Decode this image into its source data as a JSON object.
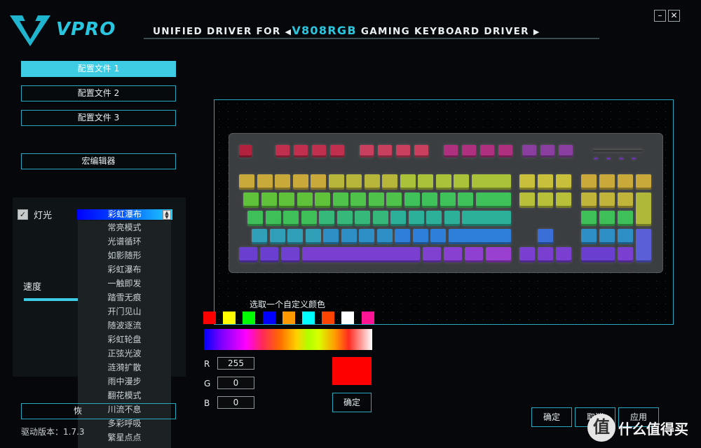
{
  "header": {
    "brand": "VPRO",
    "title_prefix": "UNIFIED DRIVER FOR",
    "model": "V808RGB",
    "title_suffix": "GAMING KEYBOARD DRIVER",
    "minimize_label": "–",
    "close_label": "✕"
  },
  "profiles": [
    "配置文件 1",
    "配置文件 2",
    "配置文件 3"
  ],
  "active_profile": 0,
  "macro_editor_label": "宏编辑器",
  "light": {
    "label": "灯光",
    "checked": true,
    "selected_mode": "彩虹瀑布",
    "modes": [
      "常亮模式",
      "光谱循环",
      "如影随形",
      "彩虹瀑布",
      "一触即发",
      "踏雪无痕",
      "开门见山",
      "随波逐流",
      "彩虹轮盘",
      "正弦光波",
      "涟漪扩散",
      "雨中漫步",
      "翻花模式",
      "川流不息",
      "多彩呼吸",
      "繁星点点"
    ],
    "speed_label": "速度"
  },
  "bottom_left_button": "恢",
  "driver_version": "驱动版本：1.7.3",
  "color_picker": {
    "title": "选取一个自定义颜色",
    "swatches": [
      "#ff0000",
      "#ffff00",
      "#00ff00",
      "#0000ff",
      "#ff9900",
      "#00ffff",
      "#ff4400",
      "#ffffff",
      "#ff1493"
    ],
    "r_label": "R",
    "r_value": "255",
    "g_label": "G",
    "g_value": "0",
    "b_label": "B",
    "b_value": "0",
    "preview_color": "#ff0000",
    "confirm_label": "确定"
  },
  "footer_buttons": {
    "ok": "确定",
    "cancel": "取消",
    "apply": "应用"
  },
  "watermark": {
    "symbol": "值",
    "text": "什么值得买"
  },
  "colors": {
    "accent": "#3ecbe4"
  }
}
